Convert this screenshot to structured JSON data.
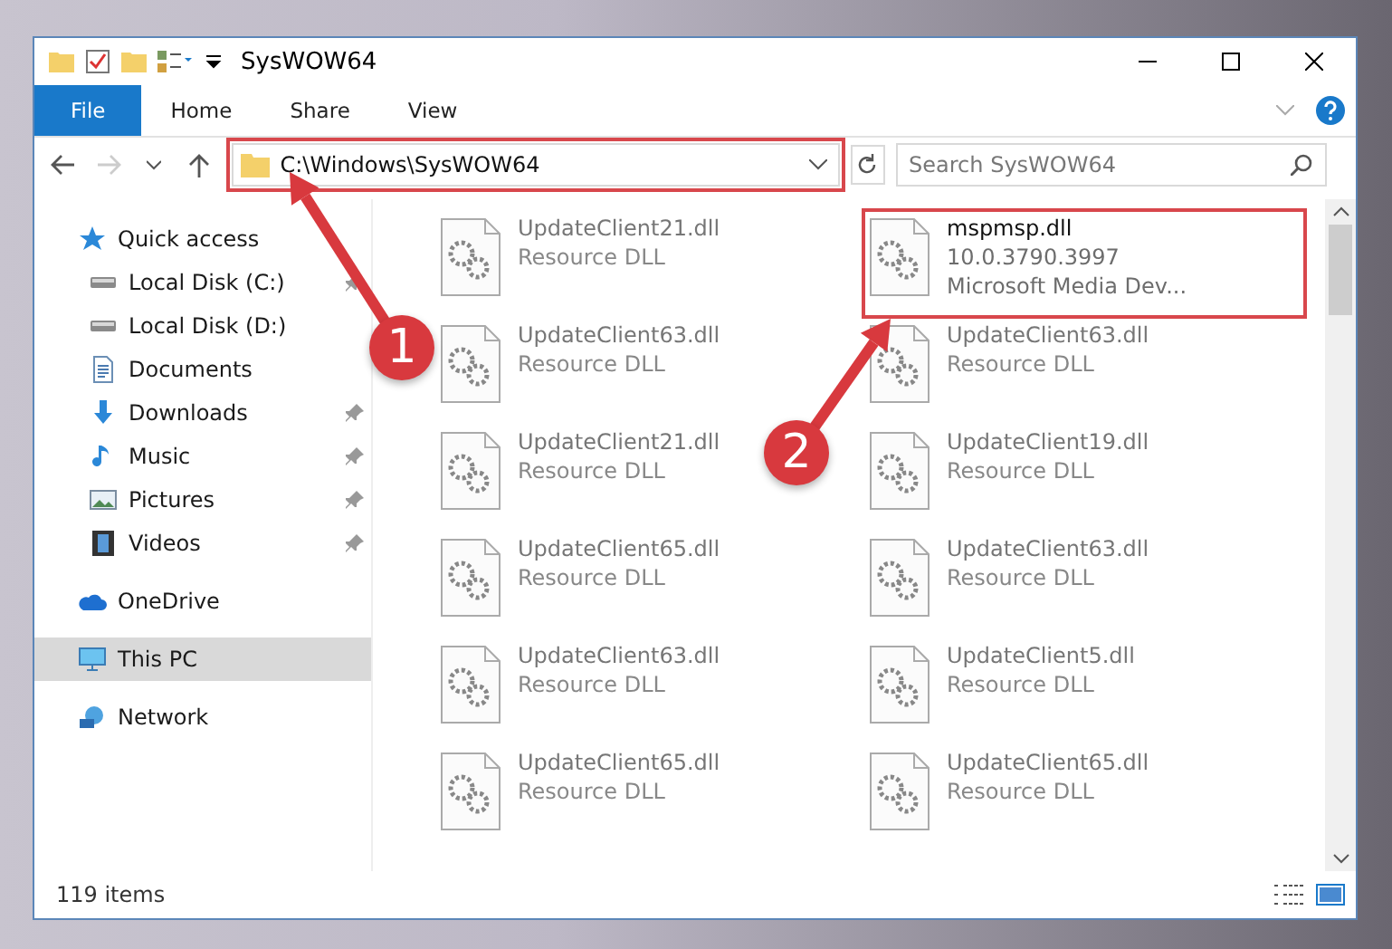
{
  "window": {
    "title": "SysWOW64"
  },
  "ribbon": {
    "tabs": [
      {
        "label": "File",
        "selected": true
      },
      {
        "label": "Home",
        "selected": false
      },
      {
        "label": "Share",
        "selected": false
      },
      {
        "label": "View",
        "selected": false
      }
    ]
  },
  "address_bar": {
    "path": "C:\\Windows\\SysWOW64",
    "highlighted": true
  },
  "search": {
    "placeholder": "Search SysWOW64"
  },
  "sidebar": {
    "items": [
      {
        "label": "Quick access",
        "kind": "star",
        "selected": false,
        "children": [
          {
            "label": "Local Disk (C:)",
            "kind": "drive",
            "pinned": true,
            "selected": false
          },
          {
            "label": "Local Disk (D:)",
            "kind": "drive",
            "selected": false
          },
          {
            "label": "Documents",
            "kind": "document",
            "selected": false
          },
          {
            "label": "Downloads",
            "kind": "download",
            "pinned": true,
            "selected": false
          },
          {
            "label": "Music",
            "kind": "music",
            "pinned": true,
            "selected": false
          },
          {
            "label": "Pictures",
            "kind": "picture",
            "pinned": true,
            "selected": false
          },
          {
            "label": "Videos",
            "kind": "video",
            "pinned": true,
            "selected": false
          }
        ]
      },
      {
        "label": "OneDrive",
        "kind": "cloud",
        "selected": false
      },
      {
        "label": "This PC",
        "kind": "pc",
        "selected": true
      },
      {
        "label": "Network",
        "kind": "network",
        "selected": false
      }
    ]
  },
  "files": [
    {
      "name": "UpdateClient21.dll",
      "details": [
        "Resource DLL"
      ],
      "dimmed": true,
      "highlighted": false
    },
    {
      "name": "mspmsp.dll",
      "details": [
        "10.0.3790.3997",
        "Microsoft Media Dev..."
      ],
      "dimmed": false,
      "highlighted": true
    },
    {
      "name": "UpdateClient63.dll",
      "details": [
        "Resource DLL"
      ],
      "dimmed": true,
      "highlighted": false
    },
    {
      "name": "UpdateClient63.dll",
      "details": [
        "Resource DLL"
      ],
      "dimmed": true,
      "highlighted": false
    },
    {
      "name": "UpdateClient21.dll",
      "details": [
        "Resource DLL"
      ],
      "dimmed": true,
      "highlighted": false
    },
    {
      "name": "UpdateClient19.dll",
      "details": [
        "Resource DLL"
      ],
      "dimmed": true,
      "highlighted": false
    },
    {
      "name": "UpdateClient65.dll",
      "details": [
        "Resource DLL"
      ],
      "dimmed": true,
      "highlighted": false
    },
    {
      "name": "UpdateClient63.dll",
      "details": [
        "Resource DLL"
      ],
      "dimmed": true,
      "highlighted": false
    },
    {
      "name": "UpdateClient63.dll",
      "details": [
        "Resource DLL"
      ],
      "dimmed": true,
      "highlighted": false
    },
    {
      "name": "UpdateClient5.dll",
      "details": [
        "Resource DLL"
      ],
      "dimmed": true,
      "highlighted": false
    },
    {
      "name": "UpdateClient65.dll",
      "details": [
        "Resource DLL"
      ],
      "dimmed": true,
      "highlighted": false
    },
    {
      "name": "UpdateClient65.dll",
      "details": [
        "Resource DLL"
      ],
      "dimmed": true,
      "highlighted": false
    }
  ],
  "status_bar": {
    "count": "119 items"
  },
  "annotations": [
    {
      "number": "1"
    },
    {
      "number": "2"
    }
  ]
}
